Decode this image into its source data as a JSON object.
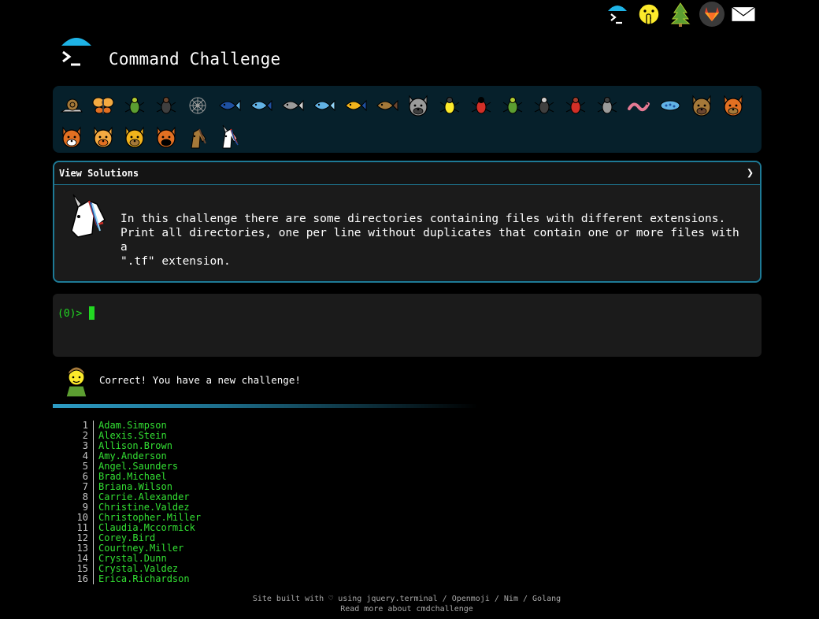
{
  "header": {
    "title": "Command Challenge"
  },
  "top_icons": [
    {
      "name": "terminal-umbrella-icon"
    },
    {
      "name": "shushing-face-icon"
    },
    {
      "name": "evergreen-tree-icon"
    },
    {
      "name": "gitlab-icon"
    },
    {
      "name": "envelope-icon"
    }
  ],
  "emoji_bar": [
    "snail",
    "butterfly",
    "bug",
    "ant",
    "spider-web",
    "whale",
    "shark",
    "dolphin",
    "fish",
    "tropical-fish",
    "blowfish",
    "wolf",
    "bee",
    "lady-beetle",
    "cricket",
    "mosquito",
    "scorpion",
    "fly",
    "worm",
    "microbe",
    "monkey",
    "dog",
    "fox",
    "cat",
    "lion",
    "tiger",
    "horse",
    "unicorn"
  ],
  "solutions": {
    "label": "View Solutions",
    "chevron": "❯",
    "text": "In this challenge there are some directories containing files with different extensions.\nPrint all directories, one per line without duplicates that contain one or more files with a\n\".tf\" extension."
  },
  "terminal": {
    "prompt": "(0)>"
  },
  "status": {
    "message": "Correct! You have a new challenge!"
  },
  "output": [
    {
      "n": "1",
      "name": "Adam.Simpson"
    },
    {
      "n": "2",
      "name": "Alexis.Stein"
    },
    {
      "n": "3",
      "name": "Allison.Brown"
    },
    {
      "n": "4",
      "name": "Amy.Anderson"
    },
    {
      "n": "5",
      "name": "Angel.Saunders"
    },
    {
      "n": "6",
      "name": "Brad.Michael"
    },
    {
      "n": "7",
      "name": "Briana.Wilson"
    },
    {
      "n": "8",
      "name": "Carrie.Alexander"
    },
    {
      "n": "9",
      "name": "Christine.Valdez"
    },
    {
      "n": "10",
      "name": "Christopher.Miller"
    },
    {
      "n": "11",
      "name": "Claudia.Mccormick"
    },
    {
      "n": "12",
      "name": "Corey.Bird"
    },
    {
      "n": "13",
      "name": "Courtney.Miller"
    },
    {
      "n": "14",
      "name": "Crystal.Dunn"
    },
    {
      "n": "15",
      "name": "Crystal.Valdez"
    },
    {
      "n": "16",
      "name": "Erica.Richardson"
    }
  ],
  "footer": {
    "line1": "Site built with ♡ using jquery.terminal / Openmoji / Nim / Golang",
    "line2": "Read more about cmdchallenge"
  }
}
